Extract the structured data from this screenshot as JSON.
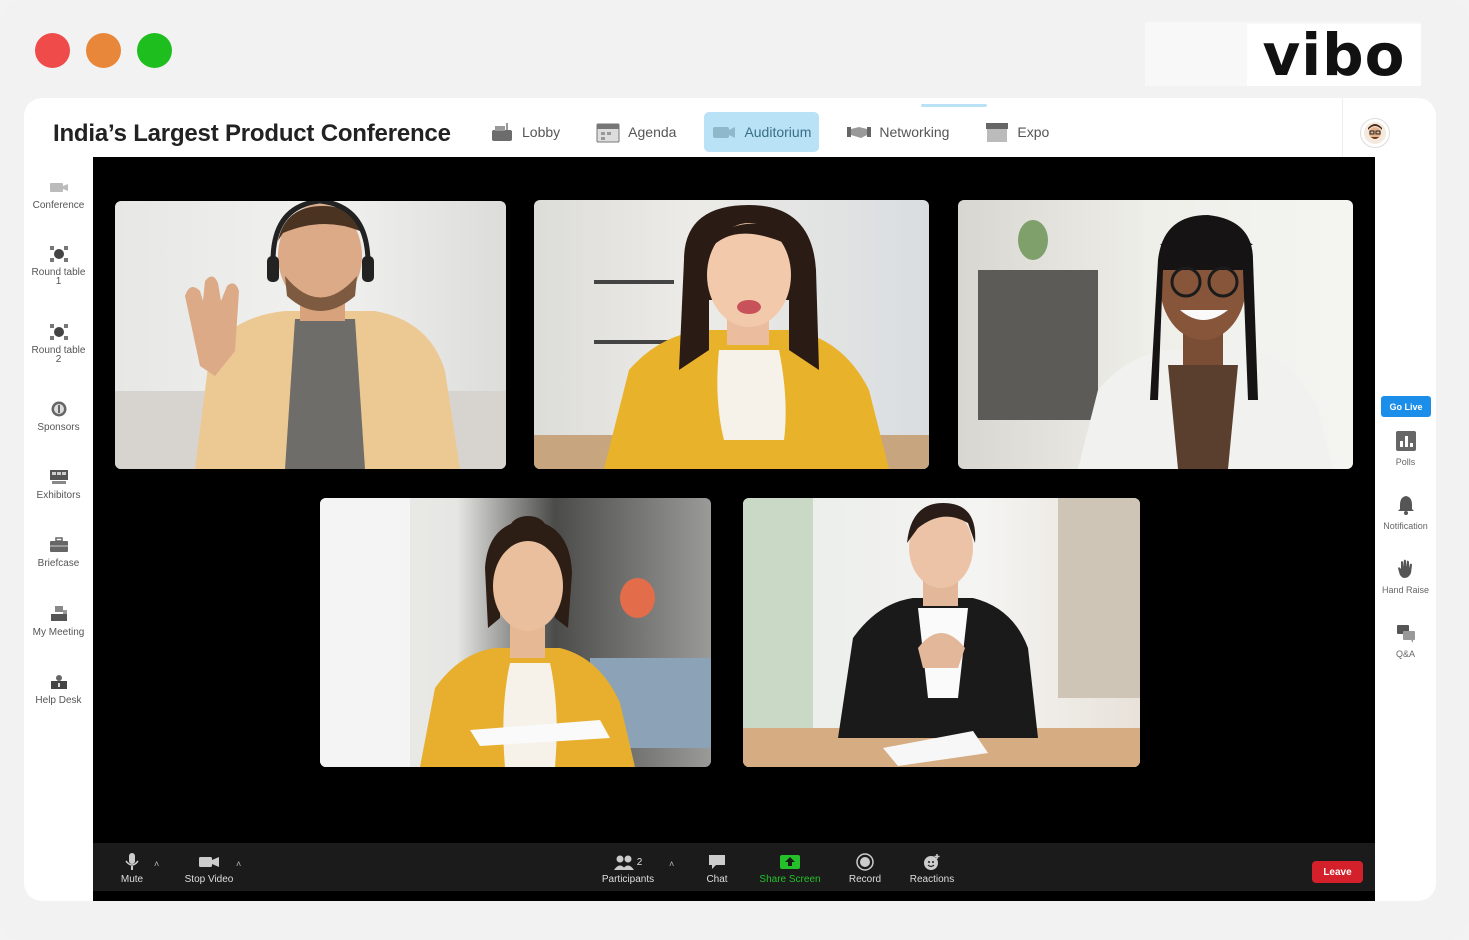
{
  "brand": {
    "logo_text": "vibo"
  },
  "event": {
    "title": "India’s Largest Product Conference"
  },
  "nav": {
    "items": [
      {
        "label": "Lobby",
        "icon": "lobby-icon"
      },
      {
        "label": "Agenda",
        "icon": "calendar-icon"
      },
      {
        "label": "Auditorium",
        "icon": "camera-icon",
        "active": true
      },
      {
        "label": "Networking",
        "icon": "handshake-icon"
      },
      {
        "label": "Expo",
        "icon": "booth-icon"
      }
    ]
  },
  "left_rail": {
    "items": [
      {
        "label": "Conference",
        "icon": "video-icon"
      },
      {
        "label": "Round table",
        "label2": "1",
        "icon": "roundtable-icon"
      },
      {
        "label": "Round table",
        "label2": "2",
        "icon": "roundtable-icon"
      },
      {
        "label": "Sponsors",
        "icon": "sponsor-coin-icon"
      },
      {
        "label": "Exhibitors",
        "icon": "exhibitors-icon"
      },
      {
        "label": "Briefcase",
        "icon": "briefcase-icon"
      },
      {
        "label": "My Meeting",
        "icon": "meeting-icon"
      },
      {
        "label": "Help Desk",
        "icon": "helpdesk-icon"
      }
    ]
  },
  "right_rail": {
    "go_live": "Go Live",
    "items": [
      {
        "label": "Polls",
        "icon": "polls-icon"
      },
      {
        "label": "Notification",
        "icon": "bell-icon"
      },
      {
        "label": "Hand Raise",
        "icon": "hand-icon"
      },
      {
        "label": "Q&A",
        "icon": "qa-icon"
      }
    ]
  },
  "controls": {
    "mute": "Mute",
    "stop_video": "Stop Video",
    "participants": "Participants",
    "participants_count": "2",
    "chat": "Chat",
    "share_screen": "Share Screen",
    "record": "Record",
    "reactions": "Reactions",
    "leave": "Leave"
  },
  "colors": {
    "accent": "#1a8ee8",
    "active_tab": "#b9e2f6",
    "leave": "#d4202a",
    "share": "#25c12b"
  }
}
